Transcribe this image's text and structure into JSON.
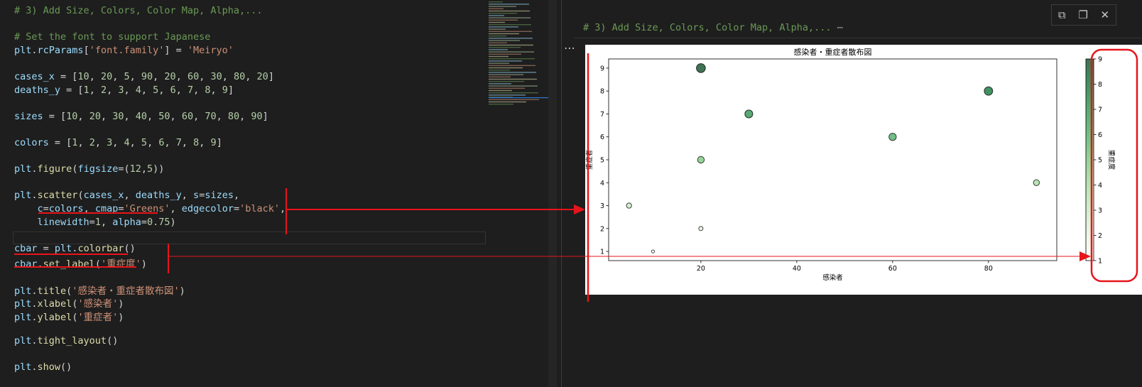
{
  "editor": {
    "lines": [
      [
        [
          "cm",
          "# 3) Add Size, Colors, Color Map, Alpha,..."
        ]
      ],
      [],
      [
        [
          "cm",
          "# Set the font to support Japanese"
        ]
      ],
      [
        [
          "var",
          "plt"
        ],
        [
          "op",
          "."
        ],
        [
          "var",
          "rcParams"
        ],
        [
          "op",
          "["
        ],
        [
          "str",
          "'font.family'"
        ],
        [
          "op",
          "] = "
        ],
        [
          "str",
          "'Meiryo'"
        ]
      ],
      [],
      [
        [
          "var",
          "cases_x"
        ],
        [
          "op",
          " = ["
        ],
        [
          "num",
          "10"
        ],
        [
          "op",
          ", "
        ],
        [
          "num",
          "20"
        ],
        [
          "op",
          ", "
        ],
        [
          "num",
          "5"
        ],
        [
          "op",
          ", "
        ],
        [
          "num",
          "90"
        ],
        [
          "op",
          ", "
        ],
        [
          "num",
          "20"
        ],
        [
          "op",
          ", "
        ],
        [
          "num",
          "60"
        ],
        [
          "op",
          ", "
        ],
        [
          "num",
          "30"
        ],
        [
          "op",
          ", "
        ],
        [
          "num",
          "80"
        ],
        [
          "op",
          ", "
        ],
        [
          "num",
          "20"
        ],
        [
          "op",
          "]"
        ]
      ],
      [
        [
          "var",
          "deaths_y"
        ],
        [
          "op",
          " = ["
        ],
        [
          "num",
          "1"
        ],
        [
          "op",
          ", "
        ],
        [
          "num",
          "2"
        ],
        [
          "op",
          ", "
        ],
        [
          "num",
          "3"
        ],
        [
          "op",
          ", "
        ],
        [
          "num",
          "4"
        ],
        [
          "op",
          ", "
        ],
        [
          "num",
          "5"
        ],
        [
          "op",
          ", "
        ],
        [
          "num",
          "6"
        ],
        [
          "op",
          ", "
        ],
        [
          "num",
          "7"
        ],
        [
          "op",
          ", "
        ],
        [
          "num",
          "8"
        ],
        [
          "op",
          ", "
        ],
        [
          "num",
          "9"
        ],
        [
          "op",
          "]"
        ]
      ],
      [],
      [
        [
          "var",
          "sizes"
        ],
        [
          "op",
          " = ["
        ],
        [
          "num",
          "10"
        ],
        [
          "op",
          ", "
        ],
        [
          "num",
          "20"
        ],
        [
          "op",
          ", "
        ],
        [
          "num",
          "30"
        ],
        [
          "op",
          ", "
        ],
        [
          "num",
          "40"
        ],
        [
          "op",
          ", "
        ],
        [
          "num",
          "50"
        ],
        [
          "op",
          ", "
        ],
        [
          "num",
          "60"
        ],
        [
          "op",
          ", "
        ],
        [
          "num",
          "70"
        ],
        [
          "op",
          ", "
        ],
        [
          "num",
          "80"
        ],
        [
          "op",
          ", "
        ],
        [
          "num",
          "90"
        ],
        [
          "op",
          "]"
        ]
      ],
      [],
      [
        [
          "var",
          "colors"
        ],
        [
          "op",
          " = ["
        ],
        [
          "num",
          "1"
        ],
        [
          "op",
          ", "
        ],
        [
          "num",
          "2"
        ],
        [
          "op",
          ", "
        ],
        [
          "num",
          "3"
        ],
        [
          "op",
          ", "
        ],
        [
          "num",
          "4"
        ],
        [
          "op",
          ", "
        ],
        [
          "num",
          "5"
        ],
        [
          "op",
          ", "
        ],
        [
          "num",
          "6"
        ],
        [
          "op",
          ", "
        ],
        [
          "num",
          "7"
        ],
        [
          "op",
          ", "
        ],
        [
          "num",
          "8"
        ],
        [
          "op",
          ", "
        ],
        [
          "num",
          "9"
        ],
        [
          "op",
          "]"
        ]
      ],
      [],
      [
        [
          "var",
          "plt"
        ],
        [
          "op",
          "."
        ],
        [
          "fn",
          "figure"
        ],
        [
          "op",
          "("
        ],
        [
          "var",
          "figsize"
        ],
        [
          "op",
          "=("
        ],
        [
          "num",
          "12"
        ],
        [
          "op",
          ","
        ],
        [
          "num",
          "5"
        ],
        [
          "op",
          "))"
        ]
      ],
      [],
      [
        [
          "var",
          "plt"
        ],
        [
          "op",
          "."
        ],
        [
          "fn",
          "scatter"
        ],
        [
          "op",
          "("
        ],
        [
          "var",
          "cases_x"
        ],
        [
          "op",
          ", "
        ],
        [
          "var",
          "deaths_y"
        ],
        [
          "op",
          ", "
        ],
        [
          "var",
          "s"
        ],
        [
          "op",
          "="
        ],
        [
          "var",
          "sizes"
        ],
        [
          "op",
          ","
        ]
      ],
      [
        [
          "op",
          "    "
        ],
        [
          "var",
          "c"
        ],
        [
          "op",
          "="
        ],
        [
          "var",
          "colors"
        ],
        [
          "op",
          ", "
        ],
        [
          "var",
          "cmap"
        ],
        [
          "op",
          "="
        ],
        [
          "str",
          "'Greens'"
        ],
        [
          "op",
          ", "
        ],
        [
          "var",
          "edgecolor"
        ],
        [
          "op",
          "="
        ],
        [
          "str",
          "'black'"
        ],
        [
          "op",
          ","
        ]
      ],
      [
        [
          "op",
          "    "
        ],
        [
          "var",
          "linewidth"
        ],
        [
          "op",
          "="
        ],
        [
          "num",
          "1"
        ],
        [
          "op",
          ", "
        ],
        [
          "var",
          "alpha"
        ],
        [
          "op",
          "="
        ],
        [
          "num",
          "0.75"
        ],
        [
          "op",
          ")"
        ]
      ],
      [],
      [
        [
          "var",
          "cbar"
        ],
        [
          "op",
          " = "
        ],
        [
          "var",
          "plt"
        ],
        [
          "op",
          "."
        ],
        [
          "fn",
          "colorbar"
        ],
        [
          "op",
          "()"
        ]
      ],
      [
        [
          "var",
          "cbar"
        ],
        [
          "op",
          "."
        ],
        [
          "fn",
          "set_label"
        ],
        [
          "op",
          "("
        ],
        [
          "str",
          "'重症度'"
        ],
        [
          "op",
          ")"
        ]
      ],
      [],
      [
        [
          "var",
          "plt"
        ],
        [
          "op",
          "."
        ],
        [
          "fn",
          "title"
        ],
        [
          "op",
          "("
        ],
        [
          "str",
          "'感染者・重症者散布図'"
        ],
        [
          "op",
          ")"
        ]
      ],
      [
        [
          "var",
          "plt"
        ],
        [
          "op",
          "."
        ],
        [
          "fn",
          "xlabel"
        ],
        [
          "op",
          "("
        ],
        [
          "str",
          "'感染者'"
        ],
        [
          "op",
          ")"
        ]
      ],
      [
        [
          "var",
          "plt"
        ],
        [
          "op",
          "."
        ],
        [
          "fn",
          "ylabel"
        ],
        [
          "op",
          "("
        ],
        [
          "str",
          "'重症者'"
        ],
        [
          "op",
          ")"
        ]
      ],
      [],
      [
        [
          "var",
          "plt"
        ],
        [
          "op",
          "."
        ],
        [
          "fn",
          "tight_layout"
        ],
        [
          "op",
          "()"
        ]
      ],
      [],
      [
        [
          "var",
          "plt"
        ],
        [
          "op",
          "."
        ],
        [
          "fn",
          "show"
        ],
        [
          "op",
          "()"
        ]
      ]
    ]
  },
  "output": {
    "cell_header": "# 3) Add Size, Colors, Color Map, Alpha,...",
    "cell_header_ellipsis": "⋯",
    "more_dots": "⋯",
    "toolbar": {
      "copy_icon": "⧉",
      "paste_icon": "❐",
      "close_icon": "✕"
    }
  },
  "chart_data": {
    "type": "scatter",
    "title": "感染者・重症者散布図",
    "xlabel": "感染者",
    "ylabel": "重症者",
    "x": [
      10,
      20,
      5,
      90,
      20,
      60,
      30,
      80,
      20
    ],
    "y": [
      1,
      2,
      3,
      4,
      5,
      6,
      7,
      8,
      9
    ],
    "sizes": [
      10,
      20,
      30,
      40,
      50,
      60,
      70,
      80,
      90
    ],
    "colors": [
      1,
      2,
      3,
      4,
      5,
      6,
      7,
      8,
      9
    ],
    "cmap": "Greens",
    "alpha": 0.75,
    "edgecolor": "black",
    "xticks": [
      20,
      40,
      60,
      80
    ],
    "yticks": [
      1,
      2,
      3,
      4,
      5,
      6,
      7,
      8,
      9
    ],
    "xlim": [
      0.75,
      94.25
    ],
    "ylim": [
      0.6,
      9.4
    ],
    "colorbar": {
      "label": "重症度",
      "ticks": [
        1,
        2,
        3,
        4,
        5,
        6,
        7,
        8,
        9
      ],
      "range": [
        1,
        9
      ]
    },
    "grid": false
  }
}
